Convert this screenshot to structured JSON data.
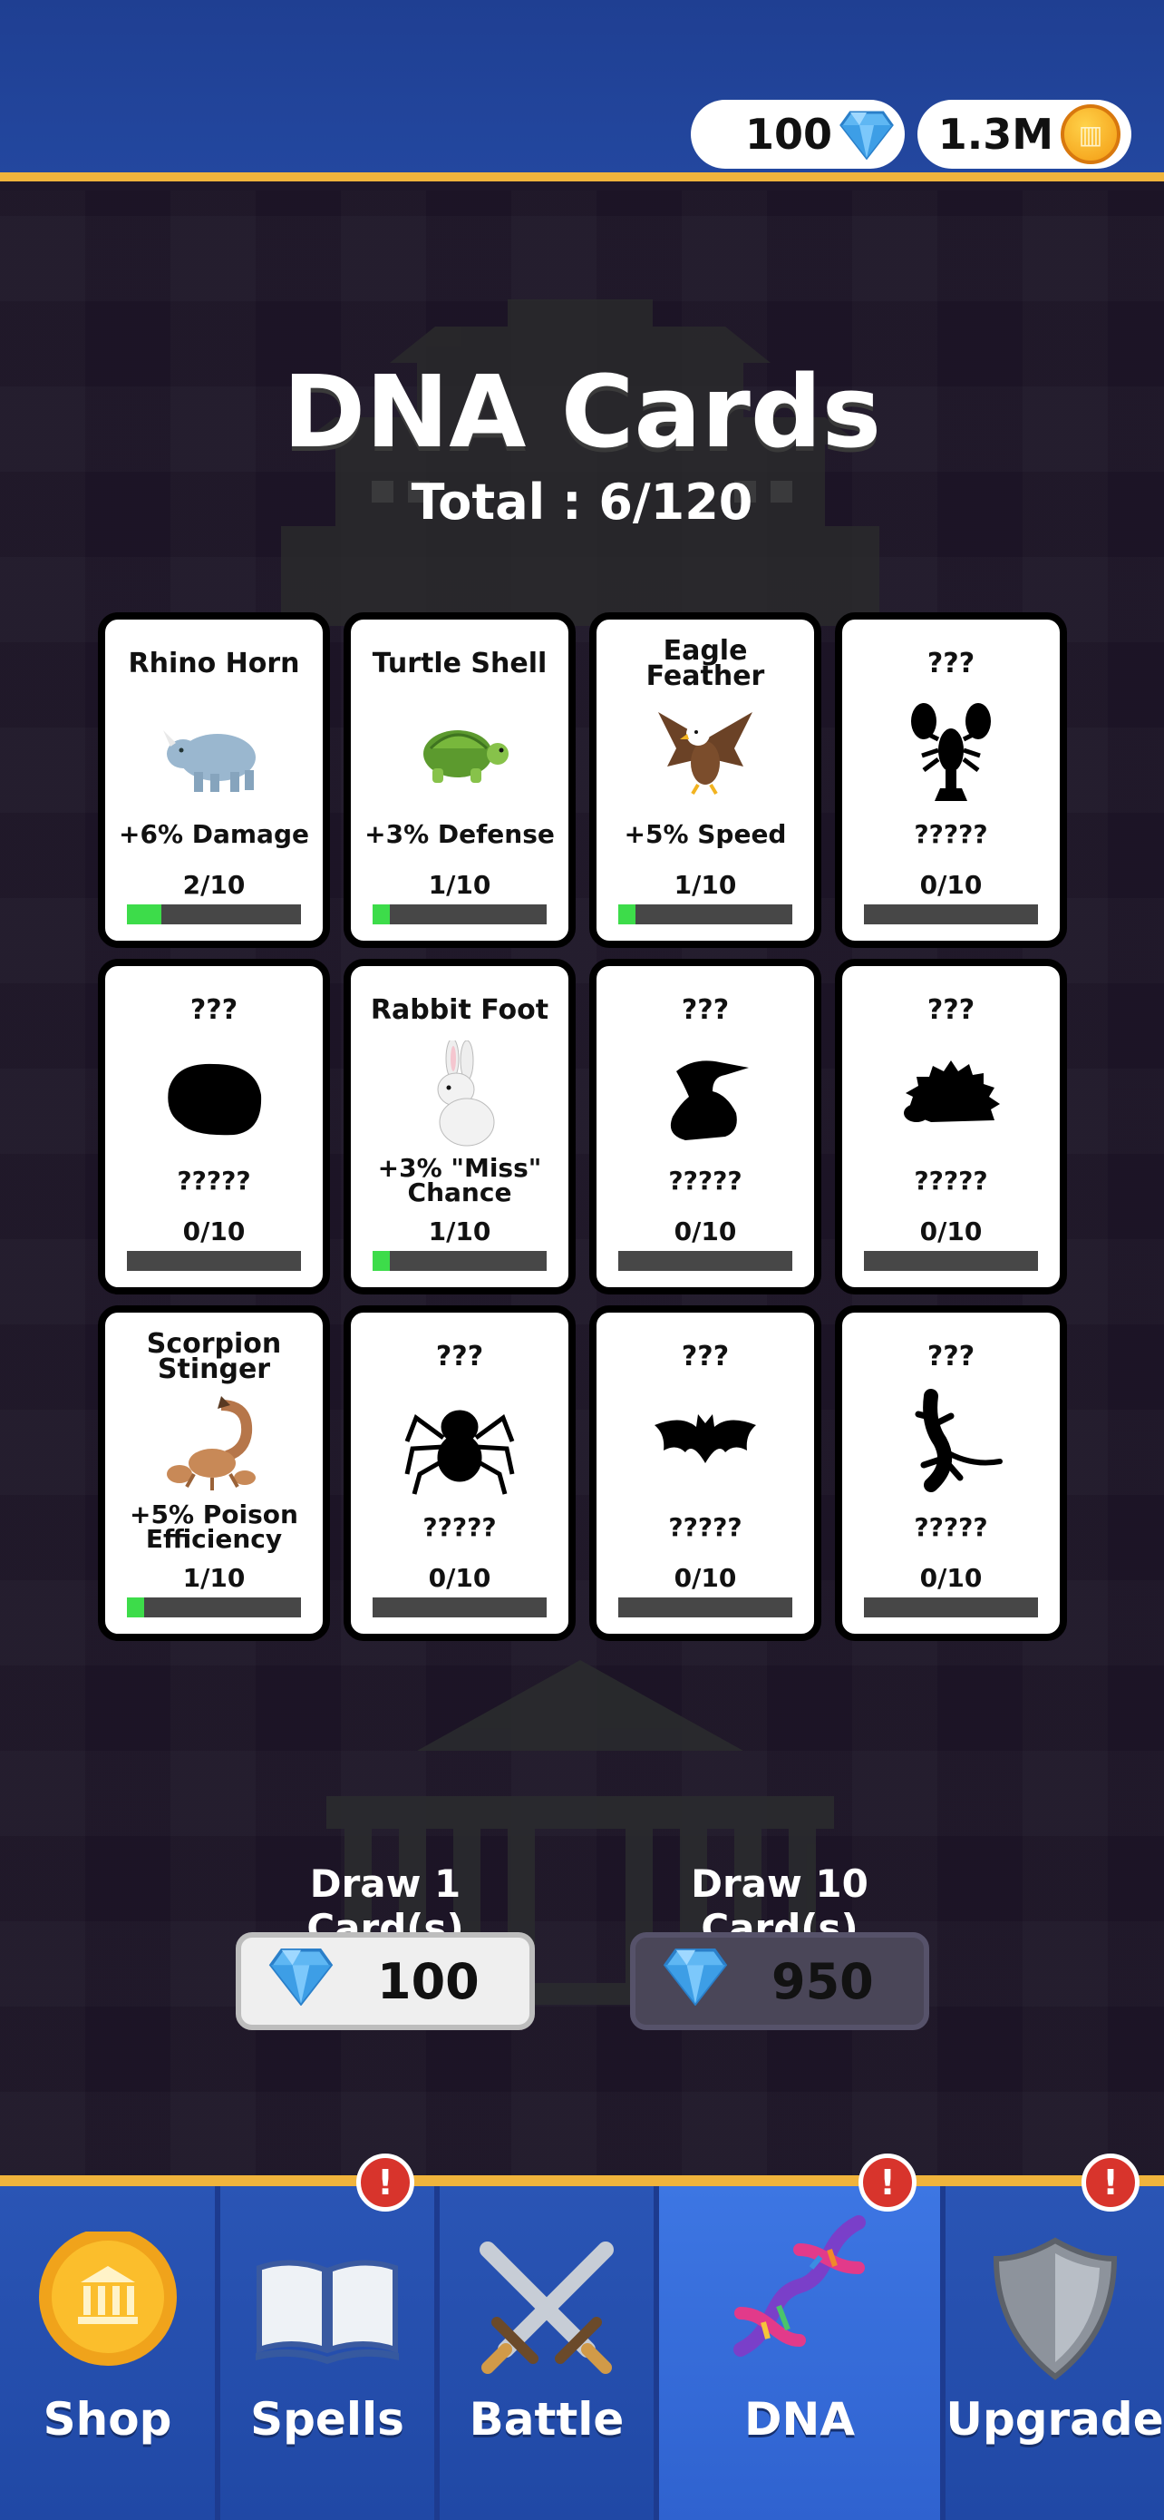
{
  "header": {
    "gems": "100",
    "coins": "1.3M"
  },
  "page": {
    "title": "DNA Cards",
    "total": "Total : 6/120"
  },
  "cards": [
    {
      "name": "Rhino Horn",
      "effect": "+6% Damage",
      "count": "2/10",
      "progress": 0.2,
      "icon": "rhino-icon",
      "unlocked": true
    },
    {
      "name": "Turtle Shell",
      "effect": "+3% Defense",
      "count": "1/10",
      "progress": 0.1,
      "icon": "turtle-icon",
      "unlocked": true
    },
    {
      "name": "Eagle Feather",
      "effect": "+5% Speed",
      "count": "1/10",
      "progress": 0.1,
      "icon": "eagle-icon",
      "unlocked": true
    },
    {
      "name": "???",
      "effect": "?????",
      "count": "0/10",
      "progress": 0,
      "icon": "lobster-silhouette-icon",
      "unlocked": false
    },
    {
      "name": "???",
      "effect": "?????",
      "count": "0/10",
      "progress": 0,
      "icon": "shell-silhouette-icon",
      "unlocked": false
    },
    {
      "name": "Rabbit Foot",
      "effect": "+3% \"Miss\" Chance",
      "count": "1/10",
      "progress": 0.1,
      "icon": "rabbit-icon",
      "unlocked": true
    },
    {
      "name": "???",
      "effect": "?????",
      "count": "0/10",
      "progress": 0,
      "icon": "crocodile-silhouette-icon",
      "unlocked": false
    },
    {
      "name": "???",
      "effect": "?????",
      "count": "0/10",
      "progress": 0,
      "icon": "hedgehog-silhouette-icon",
      "unlocked": false
    },
    {
      "name": "Scorpion Stinger",
      "effect": "+5% Poison Efficiency",
      "count": "1/10",
      "progress": 0.1,
      "icon": "scorpion-icon",
      "unlocked": true
    },
    {
      "name": "???",
      "effect": "?????",
      "count": "0/10",
      "progress": 0,
      "icon": "spider-silhouette-icon",
      "unlocked": false
    },
    {
      "name": "???",
      "effect": "?????",
      "count": "0/10",
      "progress": 0,
      "icon": "bat-silhouette-icon",
      "unlocked": false
    },
    {
      "name": "???",
      "effect": "?????",
      "count": "0/10",
      "progress": 0,
      "icon": "lizard-silhouette-icon",
      "unlocked": false
    }
  ],
  "draw": {
    "one_label": "Draw 1 Card(s)",
    "one_cost": "100",
    "ten_label": "Draw 10 Card(s)",
    "ten_cost": "950"
  },
  "nav": {
    "tabs": [
      {
        "label": "Shop",
        "icon": "coin-bank-icon",
        "alert": false,
        "active": false
      },
      {
        "label": "Spells",
        "icon": "spellbook-icon",
        "alert": true,
        "active": false
      },
      {
        "label": "Battle",
        "icon": "crossed-swords-icon",
        "alert": false,
        "active": false
      },
      {
        "label": "DNA",
        "icon": "dna-icon",
        "alert": true,
        "active": true
      },
      {
        "label": "Upgrade",
        "icon": "shield-icon",
        "alert": true,
        "active": false
      }
    ],
    "alert_symbol": "!"
  },
  "colors": {
    "header_blue": "#23479f",
    "gold_trim": "#f0b43c",
    "progress_green": "#3ddc4a",
    "alert_red": "#d8342c"
  }
}
